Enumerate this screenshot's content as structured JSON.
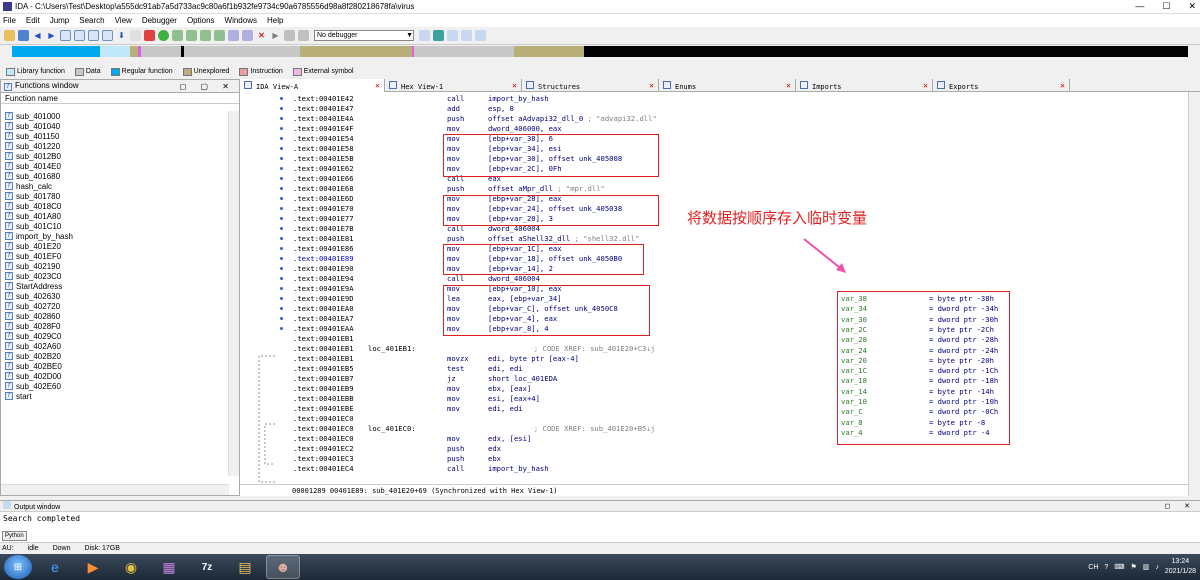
{
  "window": {
    "title": "IDA - C:\\Users\\Test\\Desktop\\a555dc91ab7a5d733ac9c80a6f1b932fe9734c90a6785556d98a8f280218678fa\\virus",
    "min": "—",
    "max": "☐",
    "close": "✕"
  },
  "menu": [
    "File",
    "Edit",
    "Jump",
    "Search",
    "View",
    "Debugger",
    "Options",
    "Windows",
    "Help"
  ],
  "toolbar": {
    "debugger_select": "No debugger"
  },
  "legend": [
    {
      "label": "Library function",
      "color": "#c0e8f8"
    },
    {
      "label": "Data",
      "color": "#c8c8c8"
    },
    {
      "label": "Regular function",
      "color": "#00a8f0"
    },
    {
      "label": "Unexplored",
      "color": "#b8b078"
    },
    {
      "label": "Instruction",
      "color": "#e8a0a0"
    },
    {
      "label": "External symbol",
      "color": "#f0b8e8"
    }
  ],
  "functions_window": {
    "title": "Functions window",
    "column": "Function name",
    "items": [
      "sub_401000",
      "sub_401040",
      "sub_401150",
      "sub_401220",
      "sub_4012B0",
      "sub_4014E0",
      "sub_401680",
      "hash_calc",
      "sub_401780",
      "sub_4018C0",
      "sub_401A80",
      "sub_401C10",
      "import_by_hash",
      "sub_401E20",
      "sub_401EF0",
      "sub_402190",
      "sub_4023C0",
      "StartAddress",
      "sub_402630",
      "sub_402720",
      "sub_402860",
      "sub_4028F0",
      "sub_4029C0",
      "sub_402A60",
      "sub_402B20",
      "sub_402BE0",
      "sub_402D00",
      "sub_402E60",
      "start"
    ]
  },
  "tabs": [
    {
      "label": "IDA View-A",
      "active": true
    },
    {
      "label": "Hex View-1"
    },
    {
      "label": "Structures"
    },
    {
      "label": "Enums"
    },
    {
      "label": "Imports"
    },
    {
      "label": "Exports"
    }
  ],
  "code": [
    {
      "addr": ".text:00401E42",
      "mn": "call",
      "op": "import_by_hash"
    },
    {
      "addr": ".text:00401E47",
      "mn": "add",
      "op": "esp, 8"
    },
    {
      "addr": ".text:00401E4A",
      "mn": "push",
      "op": "offset aAdvapi32_dll_0",
      "cmt": " ; \"advapi32.dll\""
    },
    {
      "addr": ".text:00401E4F",
      "mn": "mov",
      "op": "dword_406000, eax"
    },
    {
      "addr": ".text:00401E54",
      "mn": "mov",
      "op": "[ebp+var_38], 6"
    },
    {
      "addr": ".text:00401E58",
      "mn": "mov",
      "op": "[ebp+var_34], esi"
    },
    {
      "addr": ".text:00401E5B",
      "mn": "mov",
      "op": "[ebp+var_30], offset unk_405008"
    },
    {
      "addr": ".text:00401E62",
      "mn": "mov",
      "op": "[ebp+var_2C], 0Fh"
    },
    {
      "addr": ".text:00401E66",
      "mn": "call",
      "op": "eax"
    },
    {
      "addr": ".text:00401E68",
      "mn": "push",
      "op": "offset aMpr_dll",
      "cmt": " ; \"mpr.dll\""
    },
    {
      "addr": ".text:00401E6D",
      "mn": "mov",
      "op": "[ebp+var_28], eax"
    },
    {
      "addr": ".text:00401E70",
      "mn": "mov",
      "op": "[ebp+var_24], offset unk_405038"
    },
    {
      "addr": ".text:00401E77",
      "mn": "mov",
      "op": "[ebp+var_20], 3"
    },
    {
      "addr": ".text:00401E7B",
      "mn": "call",
      "op": "dword_406004"
    },
    {
      "addr": ".text:00401E81",
      "mn": "push",
      "op": "offset aShell32_dll",
      "cmt": " ; \"shell32.dll\""
    },
    {
      "addr": ".text:00401E86",
      "mn": "mov",
      "op": "[ebp+var_1C], eax"
    },
    {
      "addr": ".text:00401E89",
      "mn": "mov",
      "op": "[ebp+var_18], offset unk_4050B0",
      "hl": true
    },
    {
      "addr": ".text:00401E90",
      "mn": "mov",
      "op": "[ebp+var_14], 2"
    },
    {
      "addr": ".text:00401E94",
      "mn": "call",
      "op": "dword_406004"
    },
    {
      "addr": ".text:00401E9A",
      "mn": "mov",
      "op": "[ebp+var_10], eax"
    },
    {
      "addr": ".text:00401E9D",
      "mn": "lea",
      "op": "eax, [ebp+var_34]"
    },
    {
      "addr": ".text:00401EA0",
      "mn": "mov",
      "op": "[ebp+var_C], offset unk_4050C8"
    },
    {
      "addr": ".text:00401EA7",
      "mn": "mov",
      "op": "[ebp+var_4], eax"
    },
    {
      "addr": ".text:00401EAA",
      "mn": "mov",
      "op": "[ebp+var_8], 4"
    },
    {
      "addr": ".text:00401EB1",
      "mn": "",
      "op": ""
    },
    {
      "addr": ".text:00401EB1",
      "lbl": "loc_401EB1:",
      "cmt": "                        ; CODE XREF: sub_401E20+C3↓j"
    },
    {
      "addr": ".text:00401EB1",
      "mn": "movzx",
      "op": "edi, byte ptr [eax-4]"
    },
    {
      "addr": ".text:00401EB5",
      "mn": "test",
      "op": "edi, edi"
    },
    {
      "addr": ".text:00401EB7",
      "mn": "jz",
      "op": "short loc_401EDA"
    },
    {
      "addr": ".text:00401EB9",
      "mn": "mov",
      "op": "ebx, [eax]"
    },
    {
      "addr": ".text:00401EBB",
      "mn": "mov",
      "op": "esi, [eax+4]"
    },
    {
      "addr": ".text:00401EBE",
      "mn": "mov",
      "op": "edi, edi"
    },
    {
      "addr": ".text:00401EC0",
      "mn": "",
      "op": ""
    },
    {
      "addr": ".text:00401EC0",
      "lbl": "loc_401EC0:",
      "cmt": "                        ; CODE XREF: sub_401E20+B5↓j"
    },
    {
      "addr": ".text:00401EC0",
      "mn": "mov",
      "op": "edx, [esi]"
    },
    {
      "addr": ".text:00401EC2",
      "mn": "push",
      "op": "edx"
    },
    {
      "addr": ".text:00401EC3",
      "mn": "push",
      "op": "ebx"
    },
    {
      "addr": ".text:00401EC4",
      "mn": "call",
      "op": "import_by_hash"
    }
  ],
  "vars": [
    {
      "n": "var_38",
      "v": "= byte ptr -38h"
    },
    {
      "n": "var_34",
      "v": "= dword ptr -34h"
    },
    {
      "n": "var_30",
      "v": "= dword ptr -30h"
    },
    {
      "n": "var_2C",
      "v": "= byte ptr -2Ch"
    },
    {
      "n": "var_28",
      "v": "= dword ptr -28h"
    },
    {
      "n": "var_24",
      "v": "= dword ptr -24h"
    },
    {
      "n": "var_20",
      "v": "= byte ptr -20h"
    },
    {
      "n": "var_1C",
      "v": "= dword ptr -1Ch"
    },
    {
      "n": "var_18",
      "v": "= dword ptr -18h"
    },
    {
      "n": "var_14",
      "v": "= byte ptr -14h"
    },
    {
      "n": "var_10",
      "v": "= dword ptr -10h"
    },
    {
      "n": "var_C",
      "v": "= dword ptr -0Ch"
    },
    {
      "n": "var_8",
      "v": "= byte ptr -8"
    },
    {
      "n": "var_4",
      "v": "= dword ptr -4"
    }
  ],
  "annotation": "将数据按顺序存入临时变量",
  "sync_status": "00001289 00401E89: sub_401E20+69 (Synchronized with Hex View-1)",
  "output_window": {
    "title": "Output window",
    "text": "Search completed",
    "button": "Python"
  },
  "status": {
    "au": "AU:",
    "state": "idle",
    "dir": "Down",
    "disk": "Disk: 17GB"
  },
  "tray": {
    "lang": "CH",
    "time": "13:24",
    "date": "2021/1/28"
  }
}
